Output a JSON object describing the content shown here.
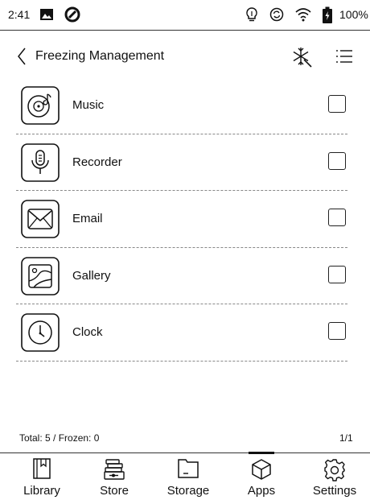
{
  "status_bar": {
    "time": "2:41",
    "battery_percent": "100%",
    "icons": [
      "image-icon",
      "app-status-icon",
      "lightbulb-icon",
      "sync-icon",
      "wifi-icon",
      "battery-icon"
    ]
  },
  "header": {
    "title": "Freezing Management",
    "icons": [
      "back-icon",
      "freeze-icon",
      "list-menu-icon"
    ]
  },
  "apps": [
    {
      "label": "Music",
      "icon": "music-icon",
      "checked": false
    },
    {
      "label": "Recorder",
      "icon": "recorder-icon",
      "checked": false
    },
    {
      "label": "Email",
      "icon": "email-icon",
      "checked": false
    },
    {
      "label": "Gallery",
      "icon": "gallery-icon",
      "checked": false
    },
    {
      "label": "Clock",
      "icon": "clock-icon",
      "checked": false
    }
  ],
  "footer": {
    "total_text": "Total: 5 / Frozen: 0",
    "page_text": "1/1"
  },
  "bottom_nav": [
    {
      "label": "Library",
      "icon": "library-icon",
      "active": false
    },
    {
      "label": "Store",
      "icon": "store-icon",
      "active": false
    },
    {
      "label": "Storage",
      "icon": "folder-icon",
      "active": false
    },
    {
      "label": "Apps",
      "icon": "apps-cube-icon",
      "active": true
    },
    {
      "label": "Settings",
      "icon": "gear-icon",
      "active": false
    }
  ]
}
